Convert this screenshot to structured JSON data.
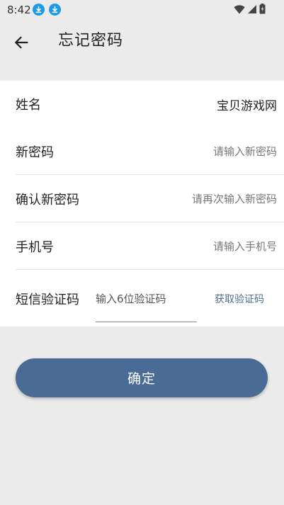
{
  "status_bar": {
    "time": "8:42",
    "icons": [
      "download-icon",
      "download-icon",
      "wifi-icon",
      "cell-signal-icon",
      "battery-icon"
    ]
  },
  "app_bar": {
    "title": "忘记密码",
    "back_icon": "arrow-left-icon"
  },
  "form": {
    "rows": [
      {
        "label": "姓名",
        "value": "宝贝游戏网",
        "placeholder": ""
      },
      {
        "label": "新密码",
        "value": "",
        "placeholder": "请输入新密码"
      },
      {
        "label": "确认新密码",
        "value": "",
        "placeholder": "请再次输入新密码"
      },
      {
        "label": "手机号",
        "value": "",
        "placeholder": "请输入手机号"
      }
    ],
    "code_row": {
      "label": "短信验证码",
      "placeholder": "输入6位验证码",
      "get_code_label": "获取验证码"
    }
  },
  "confirm_button": {
    "label": "确定"
  },
  "colors": {
    "background": "#ebebeb",
    "card": "#ffffff",
    "accent": "#4a6b96",
    "link": "#4f6d92",
    "status_icon_blue": "#1e9be6"
  }
}
